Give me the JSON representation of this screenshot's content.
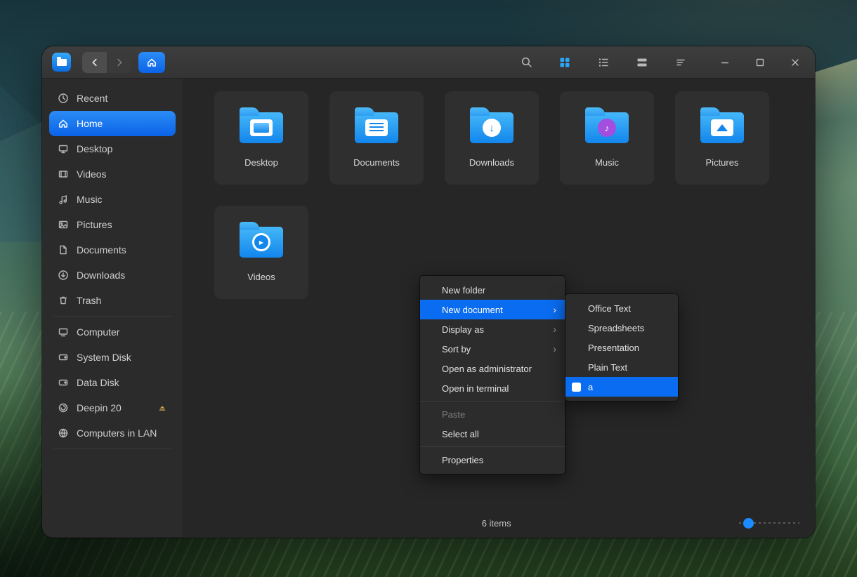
{
  "titlebar": {
    "app_name": "File Manager"
  },
  "sidebar": {
    "items": [
      {
        "label": "Recent",
        "icon": "clock"
      },
      {
        "label": "Home",
        "icon": "home",
        "active": true
      },
      {
        "label": "Desktop",
        "icon": "desktop"
      },
      {
        "label": "Videos",
        "icon": "videos"
      },
      {
        "label": "Music",
        "icon": "music"
      },
      {
        "label": "Pictures",
        "icon": "pictures"
      },
      {
        "label": "Documents",
        "icon": "documents"
      },
      {
        "label": "Downloads",
        "icon": "downloads"
      },
      {
        "label": "Trash",
        "icon": "trash"
      },
      {
        "label": "Computer",
        "icon": "computer"
      },
      {
        "label": "System Disk",
        "icon": "disk"
      },
      {
        "label": "Data Disk",
        "icon": "disk"
      },
      {
        "label": "Deepin 20",
        "icon": "disk",
        "ejectable": true
      },
      {
        "label": "Computers in LAN",
        "icon": "network"
      }
    ]
  },
  "main": {
    "folders": [
      {
        "name": "Desktop",
        "emblem": "screen"
      },
      {
        "name": "Documents",
        "emblem": "document"
      },
      {
        "name": "Downloads",
        "emblem": "down-arrow"
      },
      {
        "name": "Music",
        "emblem": "music-note"
      },
      {
        "name": "Pictures",
        "emblem": "mountain"
      },
      {
        "name": "Videos",
        "emblem": "play"
      }
    ]
  },
  "context_menu": {
    "submenu_arrow": "›",
    "items": [
      {
        "label": "New folder"
      },
      {
        "label": "New document",
        "has_submenu": true,
        "highlighted": true
      },
      {
        "label": "Display as",
        "has_submenu": true
      },
      {
        "label": "Sort by",
        "has_submenu": true
      },
      {
        "label": "Open as administrator"
      },
      {
        "label": "Open in terminal"
      },
      {
        "label": "Paste",
        "disabled": true
      },
      {
        "label": "Select all"
      },
      {
        "label": "Properties"
      }
    ]
  },
  "submenu": {
    "items": [
      {
        "label": "Office Text"
      },
      {
        "label": "Spreadsheets"
      },
      {
        "label": "Presentation"
      },
      {
        "label": "Plain Text"
      },
      {
        "label": "a",
        "highlighted": true,
        "icon": "template-file"
      }
    ]
  },
  "statusbar": {
    "items_count": "6 items"
  },
  "colors": {
    "accent": "#2ca7f8",
    "selection": "#0a6cf0",
    "folder_blue": "#1286ec"
  }
}
